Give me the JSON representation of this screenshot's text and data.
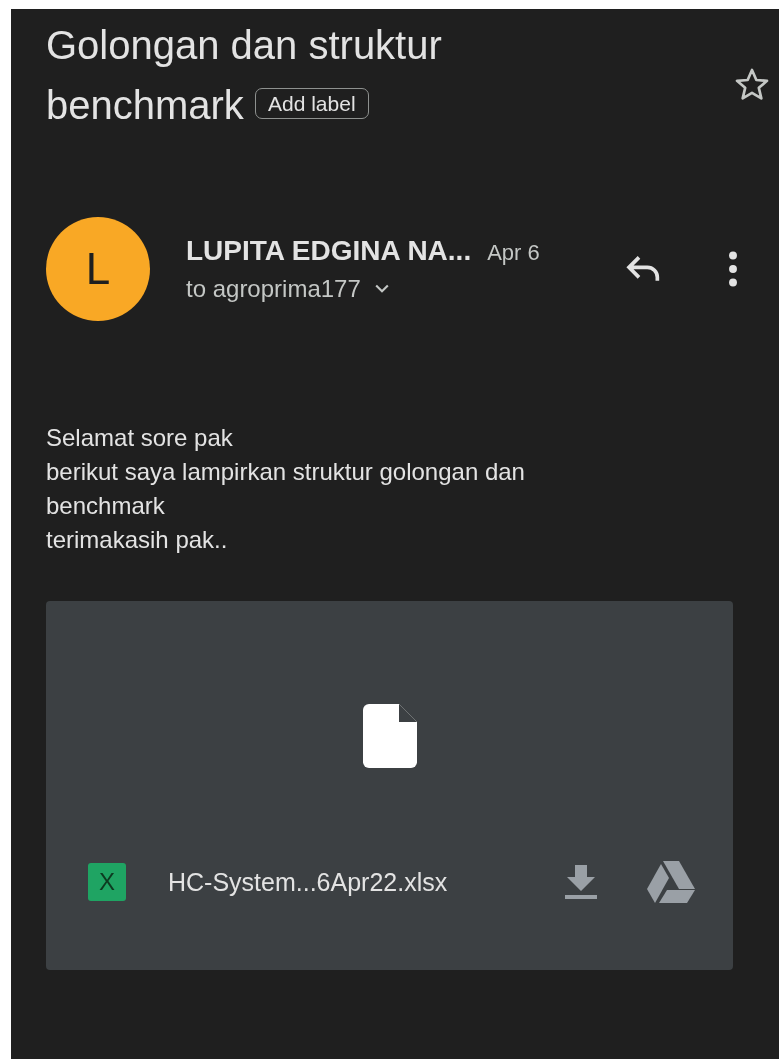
{
  "subject": {
    "title": "Golongan dan struktur benchmark",
    "label_button": "Add label",
    "starred": false
  },
  "message": {
    "avatar": {
      "letter": "L",
      "color": "#f9a825"
    },
    "sender": "LUPITA EDGINA NA...",
    "date": "Apr 6",
    "recipient": "to agroprima177",
    "body_lines": [
      "Selamat sore pak",
      "berikut saya lampirkan struktur golongan dan benchmark",
      "terimakasih pak.."
    ]
  },
  "attachment": {
    "file_type_letter": "X",
    "file_name": "HC-System...6Apr22.xlsx"
  }
}
